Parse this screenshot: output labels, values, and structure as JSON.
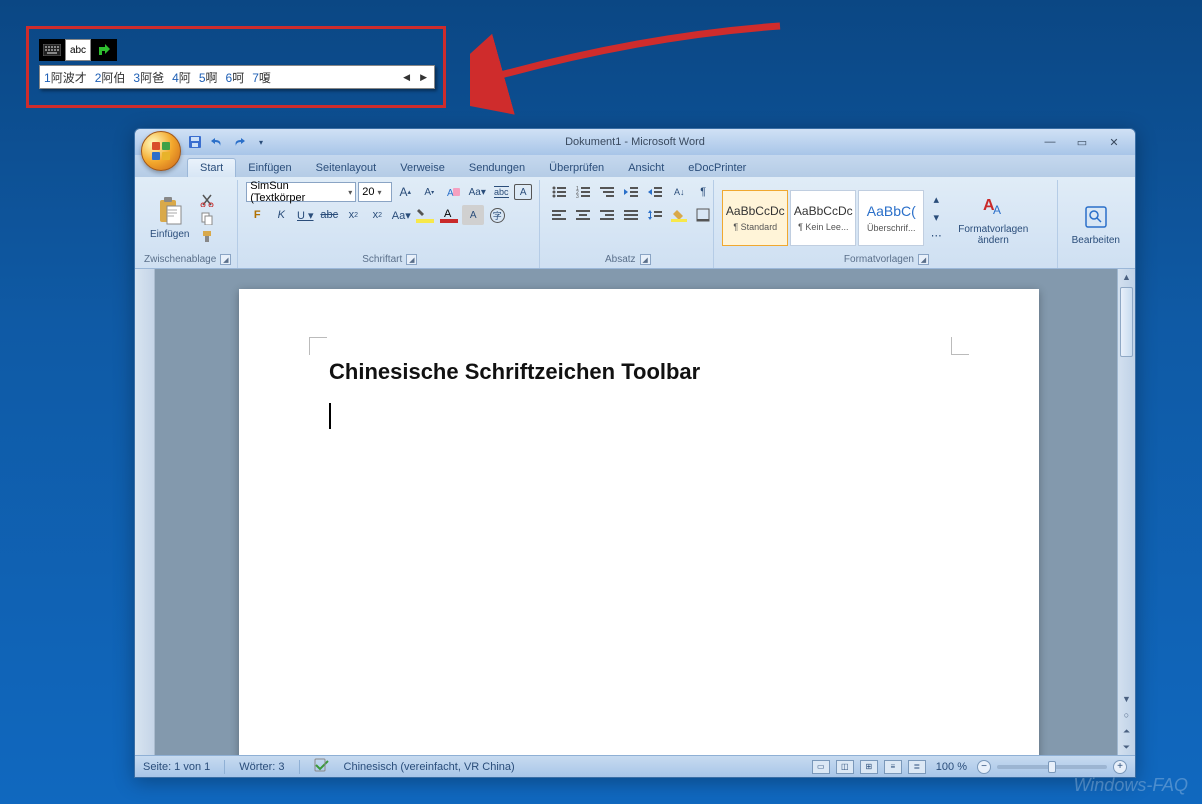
{
  "ime": {
    "input_label": "abc",
    "candidates": [
      {
        "n": "1",
        "ch": "阿波才"
      },
      {
        "n": "2",
        "ch": "阿伯"
      },
      {
        "n": "3",
        "ch": "阿爸"
      },
      {
        "n": "4",
        "ch": "阿"
      },
      {
        "n": "5",
        "ch": "啊"
      },
      {
        "n": "6",
        "ch": "呵"
      },
      {
        "n": "7",
        "ch": "嗄"
      }
    ]
  },
  "window": {
    "title": "Dokument1 - Microsoft Word"
  },
  "tabs": {
    "start": "Start",
    "einfuegen": "Einfügen",
    "seitenlayout": "Seitenlayout",
    "verweise": "Verweise",
    "sendungen": "Sendungen",
    "ueberpruefen": "Überprüfen",
    "ansicht": "Ansicht",
    "edocprinter": "eDocPrinter"
  },
  "ribbon": {
    "clipboard": {
      "paste": "Einfügen",
      "label": "Zwischenablage"
    },
    "font": {
      "font_name": "SimSun (Textkörper",
      "font_size": "20",
      "label": "Schriftart"
    },
    "paragraph": {
      "label": "Absatz"
    },
    "styles": {
      "label": "Formatvorlagen",
      "items": [
        {
          "preview": "AaBbCcDc",
          "name": "¶ Standard"
        },
        {
          "preview": "AaBbCcDc",
          "name": "¶ Kein Lee..."
        },
        {
          "preview": "AaBbC(",
          "name": "Überschrif..."
        }
      ],
      "change": "Formatvorlagen ändern"
    },
    "editing": {
      "label": "Bearbeiten"
    }
  },
  "document": {
    "heading": "Chinesische Schriftzeichen Toolbar"
  },
  "status": {
    "page": "Seite: 1 von 1",
    "words": "Wörter: 3",
    "language": "Chinesisch (vereinfacht, VR China)",
    "zoom": "100 %"
  },
  "watermark": "Windows-FAQ"
}
